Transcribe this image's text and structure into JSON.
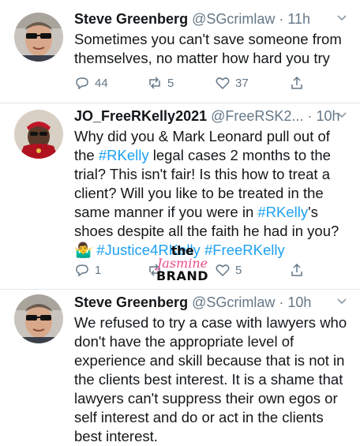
{
  "tweets": [
    {
      "name": "Steve Greenberg",
      "handle": "@SGcrimlaw",
      "time": "· 11h",
      "lines": [
        "Sometimes you can't save someone from",
        "themselves, no matter how hard you try"
      ],
      "replies": "44",
      "retweets": "5",
      "likes": "37"
    },
    {
      "name": "JO_FreeRKelly2021",
      "handle": "@FreeRSK2...",
      "time": "· 10h",
      "lines": [
        "Why did you & Mark Leonard pull out of",
        "the |#RKelly| legal cases 2 months to the",
        "trial? This isn't fair! Is this how to treat a",
        "client? Will you like to be treated in the",
        "same manner if you were in |#RKelly|'s",
        "shoes despite all the faith he had in you?",
        "🤷‍♂️ |#Justice4RKelly| |#FreeRKelly|"
      ],
      "replies": "1",
      "retweets": "",
      "likes": "5"
    },
    {
      "name": "Steve Greenberg",
      "handle": "@SGcrimlaw",
      "time": "· 10h",
      "lines": [
        "We refused to try a case with lawyers who",
        "don't have the appropriate level of",
        "experience and skill because that is not in",
        "the clients best interest.  It is a shame that",
        "lawyers can't suppress their own egos or",
        "self interest and do or act in the clients",
        "best interest."
      ]
    }
  ],
  "watermark": {
    "line1": "the",
    "line2": "Jasmine",
    "line3": "BRAND"
  },
  "colors": {
    "link": "#1da1f2",
    "muted": "#657786",
    "text": "#14171a",
    "watermark_pink": "#e84b8a"
  },
  "icons": [
    "reply-icon",
    "retweet-icon",
    "like-icon",
    "share-icon",
    "chevron-down-icon"
  ]
}
